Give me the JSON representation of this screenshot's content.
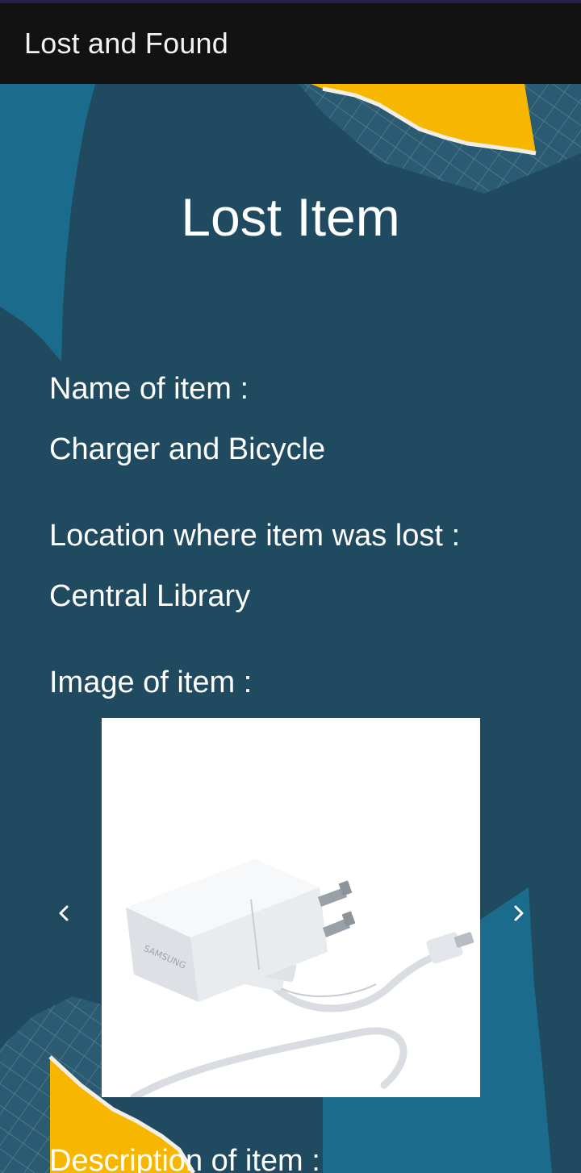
{
  "app_bar": {
    "title": "Lost and Found"
  },
  "page": {
    "title": "Lost Item"
  },
  "details": {
    "name_label": "Name of item :",
    "name_value": "Charger and Bicycle",
    "location_label": "Location where item was lost :",
    "location_value": "Central Library",
    "image_label": "Image of item :",
    "description_label": "Description of item :"
  },
  "carousel": {
    "brand_text": "SAMSUNG",
    "prev_icon": "chevron-left-icon",
    "next_icon": "chevron-right-icon"
  },
  "colors": {
    "background": "#1f4a5f",
    "app_bar": "#121212",
    "accent_yellow": "#f7b700",
    "accent_blue": "#1b6c8c",
    "text": "#ffffff"
  }
}
